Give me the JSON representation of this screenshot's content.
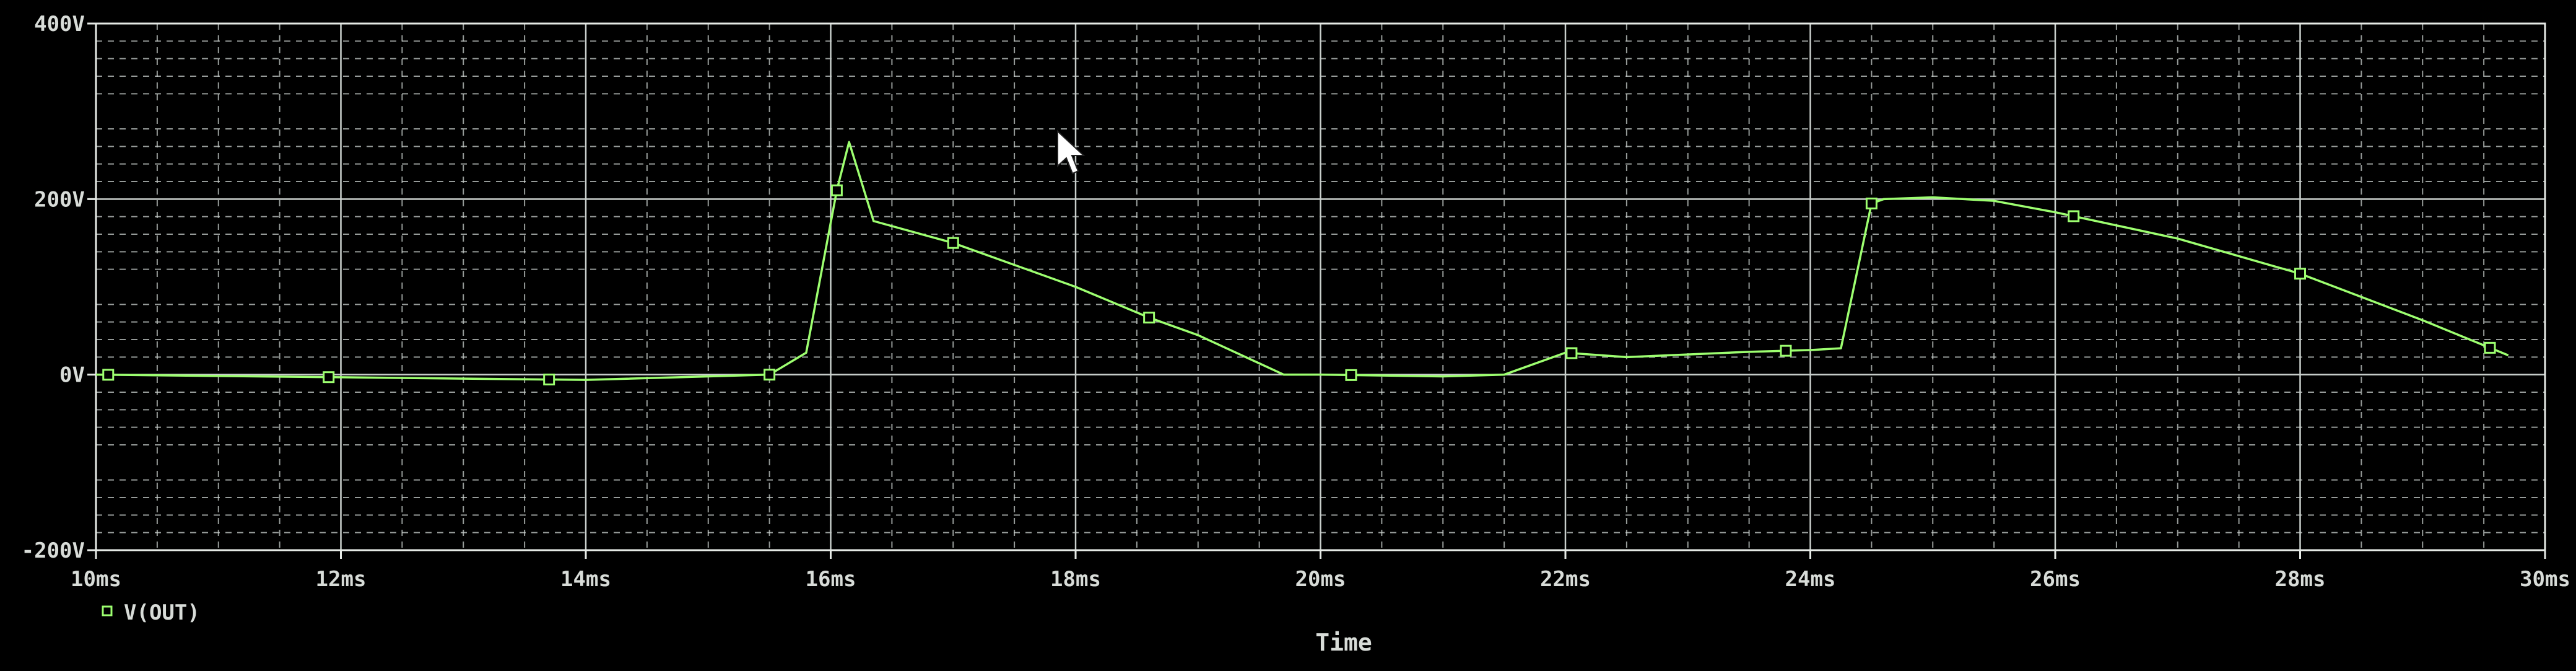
{
  "chart_data": {
    "type": "line",
    "title": "",
    "xlabel": "Time",
    "ylabel": "",
    "xlim": [
      10,
      30
    ],
    "ylim": [
      -200,
      400
    ],
    "grid": true,
    "legend_position": "bottom-left",
    "x_ticks": [
      {
        "value": 10,
        "label": "10ms"
      },
      {
        "value": 12,
        "label": "12ms"
      },
      {
        "value": 14,
        "label": "14ms"
      },
      {
        "value": 16,
        "label": "16ms"
      },
      {
        "value": 18,
        "label": "18ms"
      },
      {
        "value": 20,
        "label": "20ms"
      },
      {
        "value": 22,
        "label": "22ms"
      },
      {
        "value": 24,
        "label": "24ms"
      },
      {
        "value": 26,
        "label": "26ms"
      },
      {
        "value": 28,
        "label": "28ms"
      },
      {
        "value": 30,
        "label": "30ms"
      }
    ],
    "y_ticks": [
      {
        "value": 400,
        "label": "400V"
      },
      {
        "value": 200,
        "label": "200V"
      },
      {
        "value": 0,
        "label": "0V"
      },
      {
        "value": -200,
        "label": "-200V"
      }
    ],
    "series": [
      {
        "name": "V(OUT)",
        "color": "#9dff70",
        "marker": "square",
        "x": [
          10.0,
          12.0,
          14.0,
          15.5,
          15.8,
          16.05,
          16.15,
          16.35,
          17.0,
          18.0,
          18.6,
          19.0,
          19.7,
          20.0,
          21.0,
          21.5,
          22.0,
          22.5,
          23.0,
          23.5,
          24.0,
          24.25,
          24.5,
          24.6,
          25.0,
          25.5,
          26.0,
          27.0,
          28.0,
          29.0,
          29.7
        ],
        "y": [
          0,
          -3,
          -6,
          0,
          25,
          210,
          265,
          175,
          150,
          100,
          65,
          45,
          0,
          0,
          -2,
          0,
          25,
          20,
          23,
          26,
          28,
          30,
          195,
          200,
          202,
          198,
          185,
          155,
          115,
          62,
          22
        ],
        "marker_x": [
          10.1,
          11.9,
          13.7,
          15.5,
          16.05,
          17.0,
          18.6,
          20.25,
          22.05,
          23.8,
          24.5,
          26.15,
          28.0,
          29.55
        ]
      }
    ],
    "legend": [
      {
        "label": "V(OUT)",
        "marker": "square",
        "color": "#9dff70"
      }
    ]
  },
  "colors": {
    "background": "#000000",
    "grid": "#c9cfcc",
    "axis": "#e6eae6",
    "text": "#d8dcd8"
  },
  "icons": {
    "cursor": "arrow-pointer-icon"
  }
}
